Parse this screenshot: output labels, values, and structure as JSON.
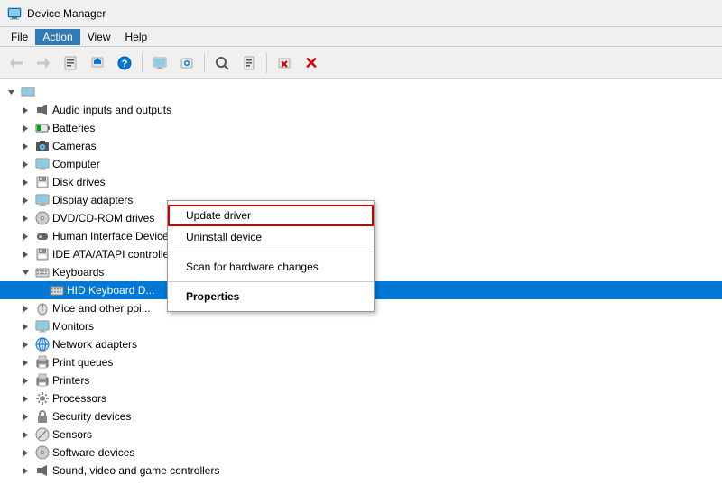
{
  "titleBar": {
    "title": "Device Manager",
    "iconSymbol": "🖥"
  },
  "menuBar": {
    "items": [
      {
        "label": "File",
        "active": false
      },
      {
        "label": "Action",
        "active": true
      },
      {
        "label": "View",
        "active": false
      },
      {
        "label": "Help",
        "active": false
      }
    ]
  },
  "toolbar": {
    "buttons": [
      {
        "id": "back",
        "symbol": "◀",
        "disabled": true
      },
      {
        "id": "forward",
        "symbol": "▶",
        "disabled": true
      },
      {
        "id": "properties",
        "symbol": "📋",
        "disabled": false
      },
      {
        "id": "update",
        "symbol": "⬆",
        "disabled": false
      },
      {
        "id": "help",
        "symbol": "❓",
        "disabled": false
      },
      {
        "id": "sep1",
        "type": "sep"
      },
      {
        "id": "print",
        "symbol": "🖨",
        "disabled": false
      },
      {
        "id": "sep2",
        "type": "sep"
      },
      {
        "id": "scan",
        "symbol": "🔍",
        "disabled": false
      },
      {
        "id": "deviceinfo",
        "symbol": "ℹ",
        "disabled": false
      },
      {
        "id": "sep3",
        "type": "sep"
      },
      {
        "id": "uninstall",
        "symbol": "🚫",
        "disabled": false
      },
      {
        "id": "delete",
        "symbol": "✕",
        "disabled": false,
        "class": "red-x"
      }
    ]
  },
  "treeItems": [
    {
      "id": "root",
      "level": 0,
      "expand": "▼",
      "icon": "💻",
      "label": "",
      "selected": false
    },
    {
      "id": "audio",
      "level": 1,
      "expand": "▶",
      "icon": "🔊",
      "label": "Audio inputs and outputs",
      "selected": false
    },
    {
      "id": "batteries",
      "level": 1,
      "expand": "▶",
      "icon": "🔋",
      "label": "Batteries",
      "selected": false
    },
    {
      "id": "cameras",
      "level": 1,
      "expand": "▶",
      "icon": "📷",
      "label": "Cameras",
      "selected": false
    },
    {
      "id": "computer",
      "level": 1,
      "expand": "▶",
      "icon": "🖥",
      "label": "Computer",
      "selected": false
    },
    {
      "id": "diskdrives",
      "level": 1,
      "expand": "▶",
      "icon": "💾",
      "label": "Disk drives",
      "selected": false
    },
    {
      "id": "displayadapters",
      "level": 1,
      "expand": "▶",
      "icon": "🖥",
      "label": "Display adapters",
      "selected": false
    },
    {
      "id": "dvdrom",
      "level": 1,
      "expand": "▶",
      "icon": "💿",
      "label": "DVD/CD-ROM drives",
      "selected": false
    },
    {
      "id": "hid",
      "level": 1,
      "expand": "▶",
      "icon": "🎮",
      "label": "Human Interface Devices",
      "selected": false
    },
    {
      "id": "ideata",
      "level": 1,
      "expand": "▶",
      "icon": "💾",
      "label": "IDE ATA/ATAPI controllers",
      "selected": false
    },
    {
      "id": "keyboards",
      "level": 1,
      "expand": "▼",
      "icon": "⌨",
      "label": "Keyboards",
      "selected": false
    },
    {
      "id": "hidkeyboard",
      "level": 2,
      "expand": "",
      "icon": "⌨",
      "label": "HID Keyboard D...",
      "selected": true,
      "highlighted": true
    },
    {
      "id": "mice",
      "level": 1,
      "expand": "▶",
      "icon": "🖱",
      "label": "Mice and other poi...",
      "selected": false
    },
    {
      "id": "monitors",
      "level": 1,
      "expand": "▶",
      "icon": "🖥",
      "label": "Monitors",
      "selected": false
    },
    {
      "id": "networkadapters",
      "level": 1,
      "expand": "▶",
      "icon": "🌐",
      "label": "Network adapters",
      "selected": false
    },
    {
      "id": "printqueues",
      "level": 1,
      "expand": "▶",
      "icon": "🖨",
      "label": "Print queues",
      "selected": false
    },
    {
      "id": "printers",
      "level": 1,
      "expand": "▶",
      "icon": "🖨",
      "label": "Printers",
      "selected": false
    },
    {
      "id": "processors",
      "level": 1,
      "expand": "▶",
      "icon": "⚙",
      "label": "Processors",
      "selected": false
    },
    {
      "id": "security",
      "level": 1,
      "expand": "▶",
      "icon": "🔒",
      "label": "Security devices",
      "selected": false
    },
    {
      "id": "sensors",
      "level": 1,
      "expand": "▶",
      "icon": "📡",
      "label": "Sensors",
      "selected": false
    },
    {
      "id": "software",
      "level": 1,
      "expand": "▶",
      "icon": "💿",
      "label": "Software devices",
      "selected": false
    },
    {
      "id": "sound",
      "level": 1,
      "expand": "▶",
      "icon": "🔊",
      "label": "Sound, video and game controllers",
      "selected": false
    }
  ],
  "contextMenu": {
    "items": [
      {
        "id": "update-driver",
        "label": "Update driver",
        "bold": false,
        "highlighted": true
      },
      {
        "id": "uninstall-device",
        "label": "Uninstall device",
        "bold": false
      },
      {
        "id": "sep1",
        "type": "sep"
      },
      {
        "id": "scan-changes",
        "label": "Scan for hardware changes",
        "bold": false
      },
      {
        "id": "sep2",
        "type": "sep"
      },
      {
        "id": "properties",
        "label": "Properties",
        "bold": true
      }
    ]
  }
}
